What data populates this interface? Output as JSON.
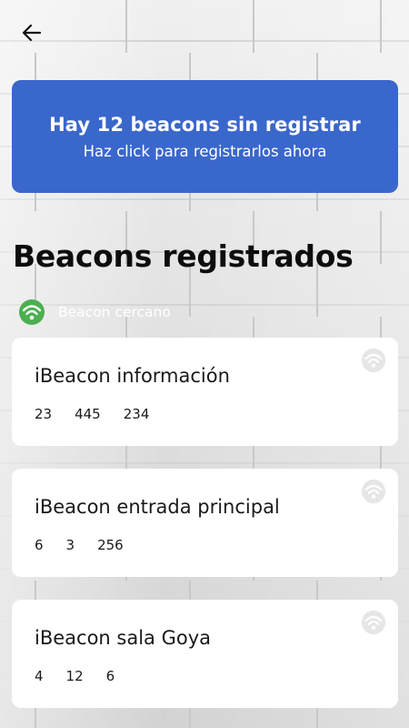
{
  "header": {
    "back_icon": "arrow-left-icon"
  },
  "banner": {
    "title": "Hay 12 beacons sin registrar",
    "subtitle": "Haz click para registrarlos ahora",
    "color": "#3a67cc"
  },
  "section": {
    "title": "Beacons registrados"
  },
  "legend": {
    "icon": "wifi-signal-icon",
    "icon_color": "#4caf50",
    "label": "Beacon cercano"
  },
  "beacons": [
    {
      "name": "iBeacon información",
      "uuid_part": "23",
      "major": "445",
      "minor": "234",
      "nearby": false
    },
    {
      "name": "iBeacon entrada principal",
      "uuid_part": "6",
      "major": "3",
      "minor": "256",
      "nearby": false
    },
    {
      "name": "iBeacon sala Goya",
      "uuid_part": "4",
      "major": "12",
      "minor": "6",
      "nearby": false
    }
  ],
  "colors": {
    "nearby": "#4caf50",
    "not_nearby": "#e6e6e6"
  }
}
